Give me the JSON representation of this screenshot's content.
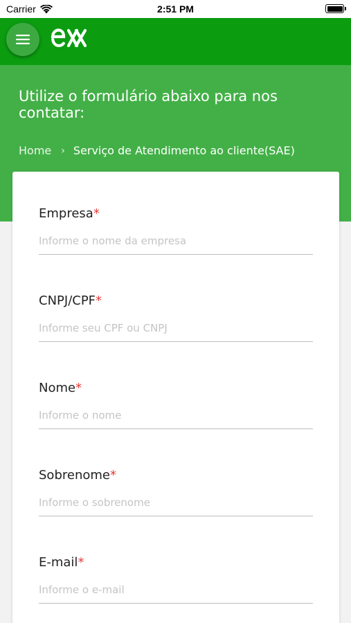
{
  "status_bar": {
    "carrier": "Carrier",
    "time": "2:51 PM"
  },
  "app_bar": {
    "menu_icon": "hamburger-menu-icon",
    "logo_icon": "ex-logo-icon"
  },
  "hero": {
    "title": "Utilize o formulário abaixo para nos contatar:",
    "breadcrumb": {
      "home": "Home",
      "separator": "›",
      "current": "Serviço de Atendimento ao cliente(SAE)"
    }
  },
  "form": {
    "required_marker": "*",
    "fields": [
      {
        "label": "Empresa",
        "placeholder": "Informe o nome da empresa"
      },
      {
        "label": "CNPJ/CPF",
        "placeholder": "Informe seu CPF ou CNPJ"
      },
      {
        "label": "Nome",
        "placeholder": "Informe o nome"
      },
      {
        "label": "Sobrenome",
        "placeholder": "Informe o sobrenome"
      },
      {
        "label": "E-mail",
        "placeholder": "Informe o e-mail"
      }
    ]
  },
  "colors": {
    "app_bar": "#0b9c10",
    "hero": "#43b047",
    "required": "#e53935"
  }
}
